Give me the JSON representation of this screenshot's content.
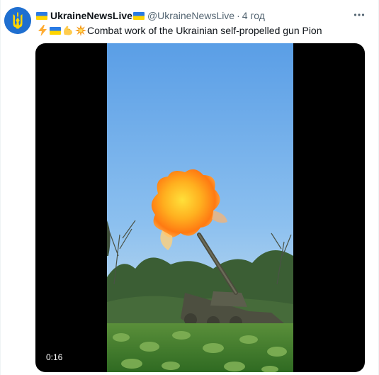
{
  "author": {
    "display_name": "UkraineNewsLive",
    "handle": "@UkraineNewsLive",
    "separator": "·",
    "timestamp": "4 год",
    "avatar_icon": "ukraine-trident-icon",
    "avatar_color": "#1f6fd0"
  },
  "tweet": {
    "emojis": [
      "lightning-emoji",
      "ukraine-flag-emoji",
      "flexed-biceps-emoji",
      "collision-emoji"
    ],
    "text": "Combat work of the Ukrainian self-propelled gun Pion"
  },
  "media": {
    "type": "video",
    "duration": "0:16"
  },
  "colors": {
    "flag_blue": "#2a7be4",
    "flag_yellow": "#ffd500",
    "secondary_text": "#536471",
    "primary_text": "#0f1419"
  }
}
